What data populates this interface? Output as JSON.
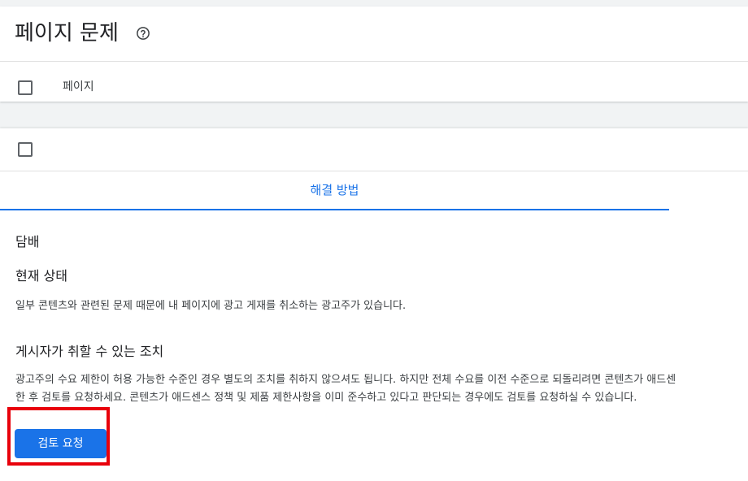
{
  "header": {
    "title": "페이지 문제",
    "help_icon": "help-circle-icon",
    "column_label": "페이지"
  },
  "detail": {
    "tab_label": "해결 방법",
    "category": "담배",
    "status_heading": "현재 상태",
    "status_text": "일부 콘텐츠와 관련된 문제 때문에 내 페이지에 광고 게재를 취소하는 광고주가 있습니다.",
    "actions_heading": "게시자가 취할 수 있는 조치",
    "actions_text_line1": "광고주의 수요 제한이 허용 가능한 수준인 경우 별도의 조치를 취하지 않으셔도 됩니다. 하지만 전체 수요를 이전 수준으로 되돌리려면 콘텐츠가 애드센",
    "actions_text_line2": "한 후 검토를 요청하세요. 콘텐츠가 애드센스 정책 및 제품 제한사항을 이미 준수하고 있다고 판단되는 경우에도 검토를 요청하실 수 있습니다.",
    "review_button_label": "검토 요청"
  },
  "colors": {
    "accent": "#1a73e8",
    "highlight": "#e8000b",
    "text_primary": "#202124",
    "text_secondary": "#3c4043",
    "background": "#f1f3f4"
  }
}
